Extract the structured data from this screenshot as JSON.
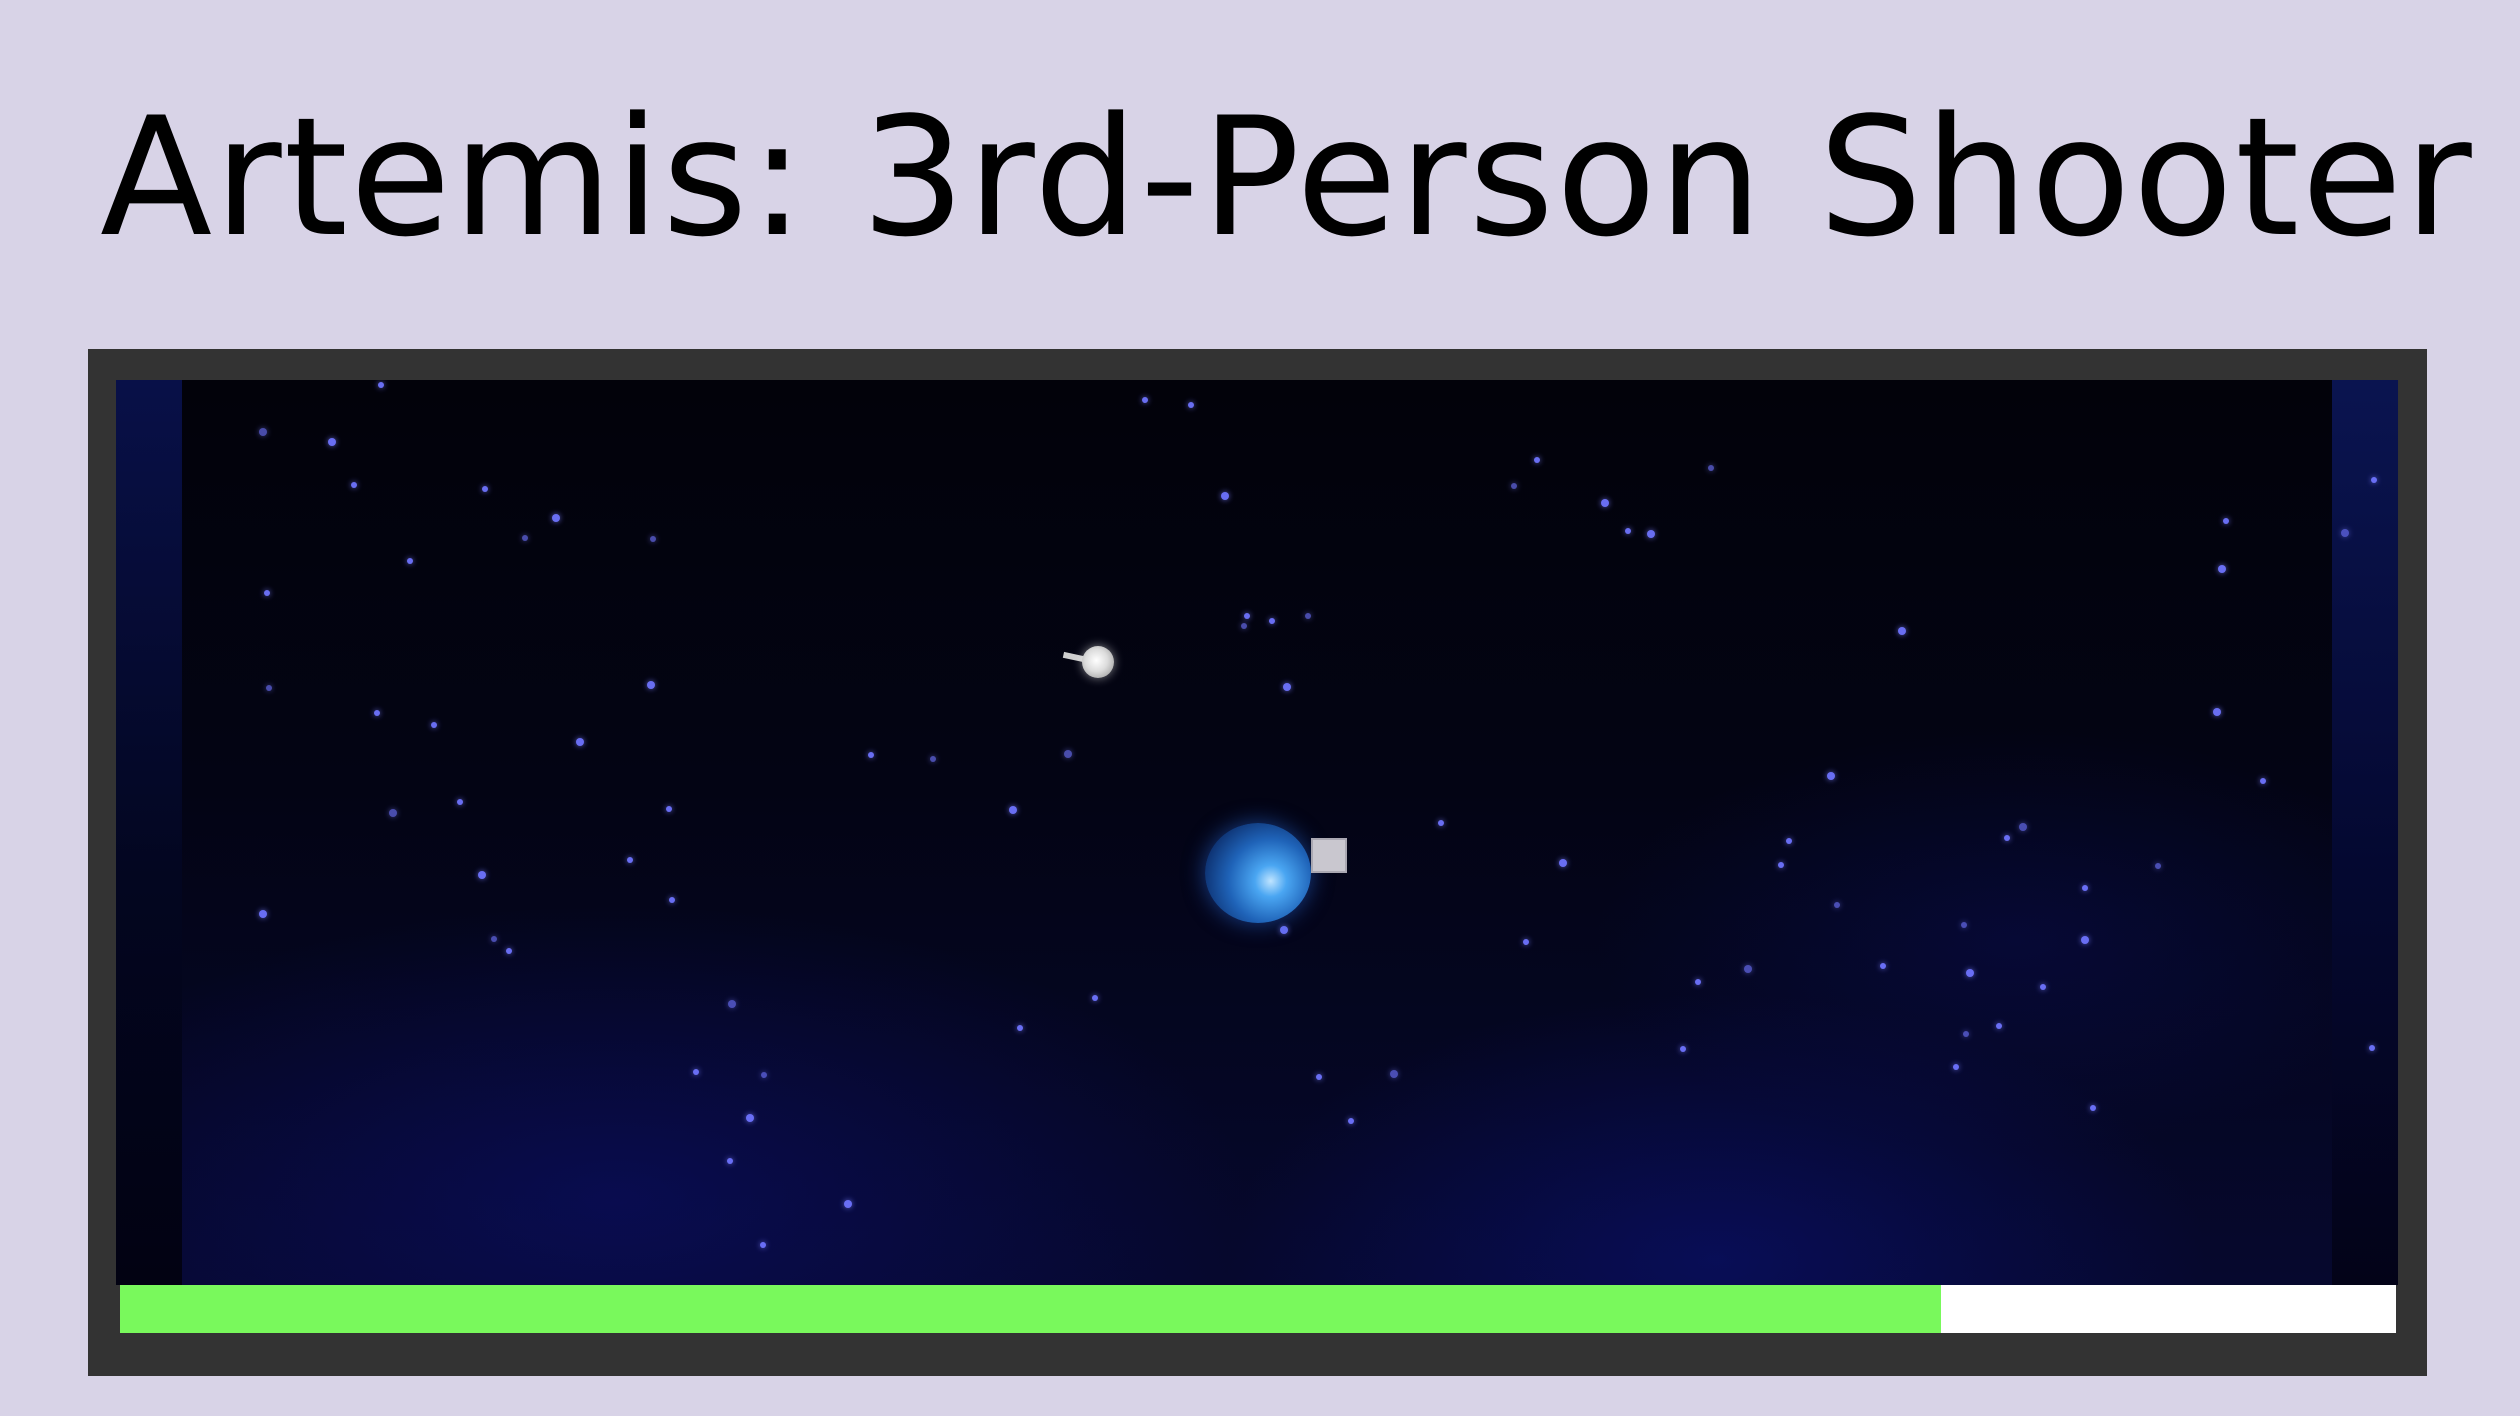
{
  "title": "Artemis: 3rd-Person Shooter",
  "game": {
    "health_fraction": 0.8,
    "colors": {
      "page_background": "#d8d3e7",
      "frame": "#333333",
      "space": "#02020c",
      "star": "#6f74ff",
      "player_ship": "#4aa6f2",
      "player_gun": "#c9c7cf",
      "enemy": "#dcdcdc",
      "health_fill": "#79f95c",
      "health_empty": "#ffffff"
    },
    "icons": {
      "player": "blue-orb-ship-icon",
      "player_gun": "square-turret-icon",
      "enemy": "white-orb-enemy-icon"
    }
  }
}
